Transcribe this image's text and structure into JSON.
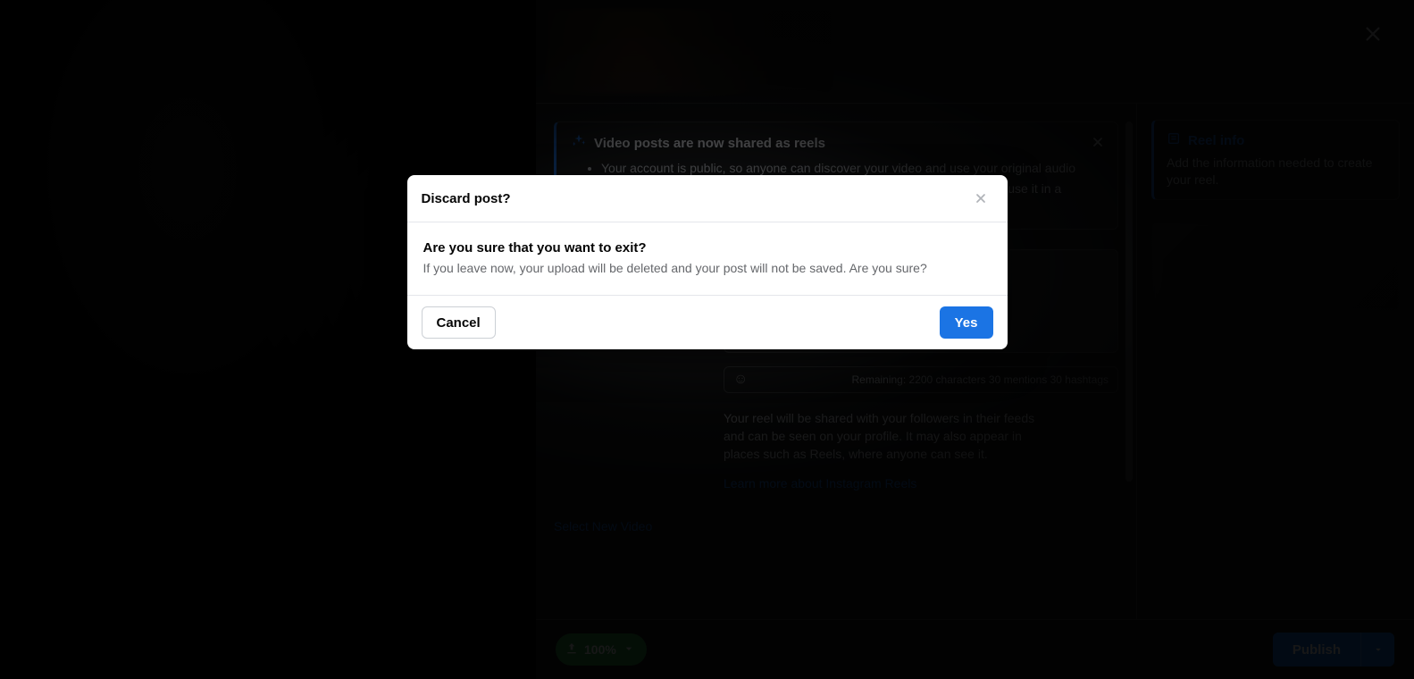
{
  "modal": {
    "title": "Discard post?",
    "question": "Are you sure that you want to exit?",
    "body": "If you leave now, your upload will be deleted and your post will not be saved. Are you sure?",
    "cancel_label": "Cancel",
    "yes_label": "Yes"
  },
  "callout": {
    "title": "Video posts are now shared as reels",
    "bullets": [
      "Your account is public, so anyone can discover your video and use your original audio",
      "Reels may appear in places such as Reels, where anyone can see it and use it in a remix. You"
    ]
  },
  "caption": {
    "remaining_text": "Remaining: 2200 characters 30 mentions 30 hashtags"
  },
  "share_note": "Your reel will be shared with your followers in their feeds and can be seen on your profile. It may also appear in places such as Reels, where anyone can see it.",
  "learn_more": "Learn more about Instagram Reels",
  "select_new": "Select New Video",
  "sidebar": {
    "reel_info_title": "Reel info",
    "reel_info_desc": "Add the information needed to create your reel."
  },
  "footer": {
    "upload_pct": "100%",
    "publish_label": "Publish"
  }
}
